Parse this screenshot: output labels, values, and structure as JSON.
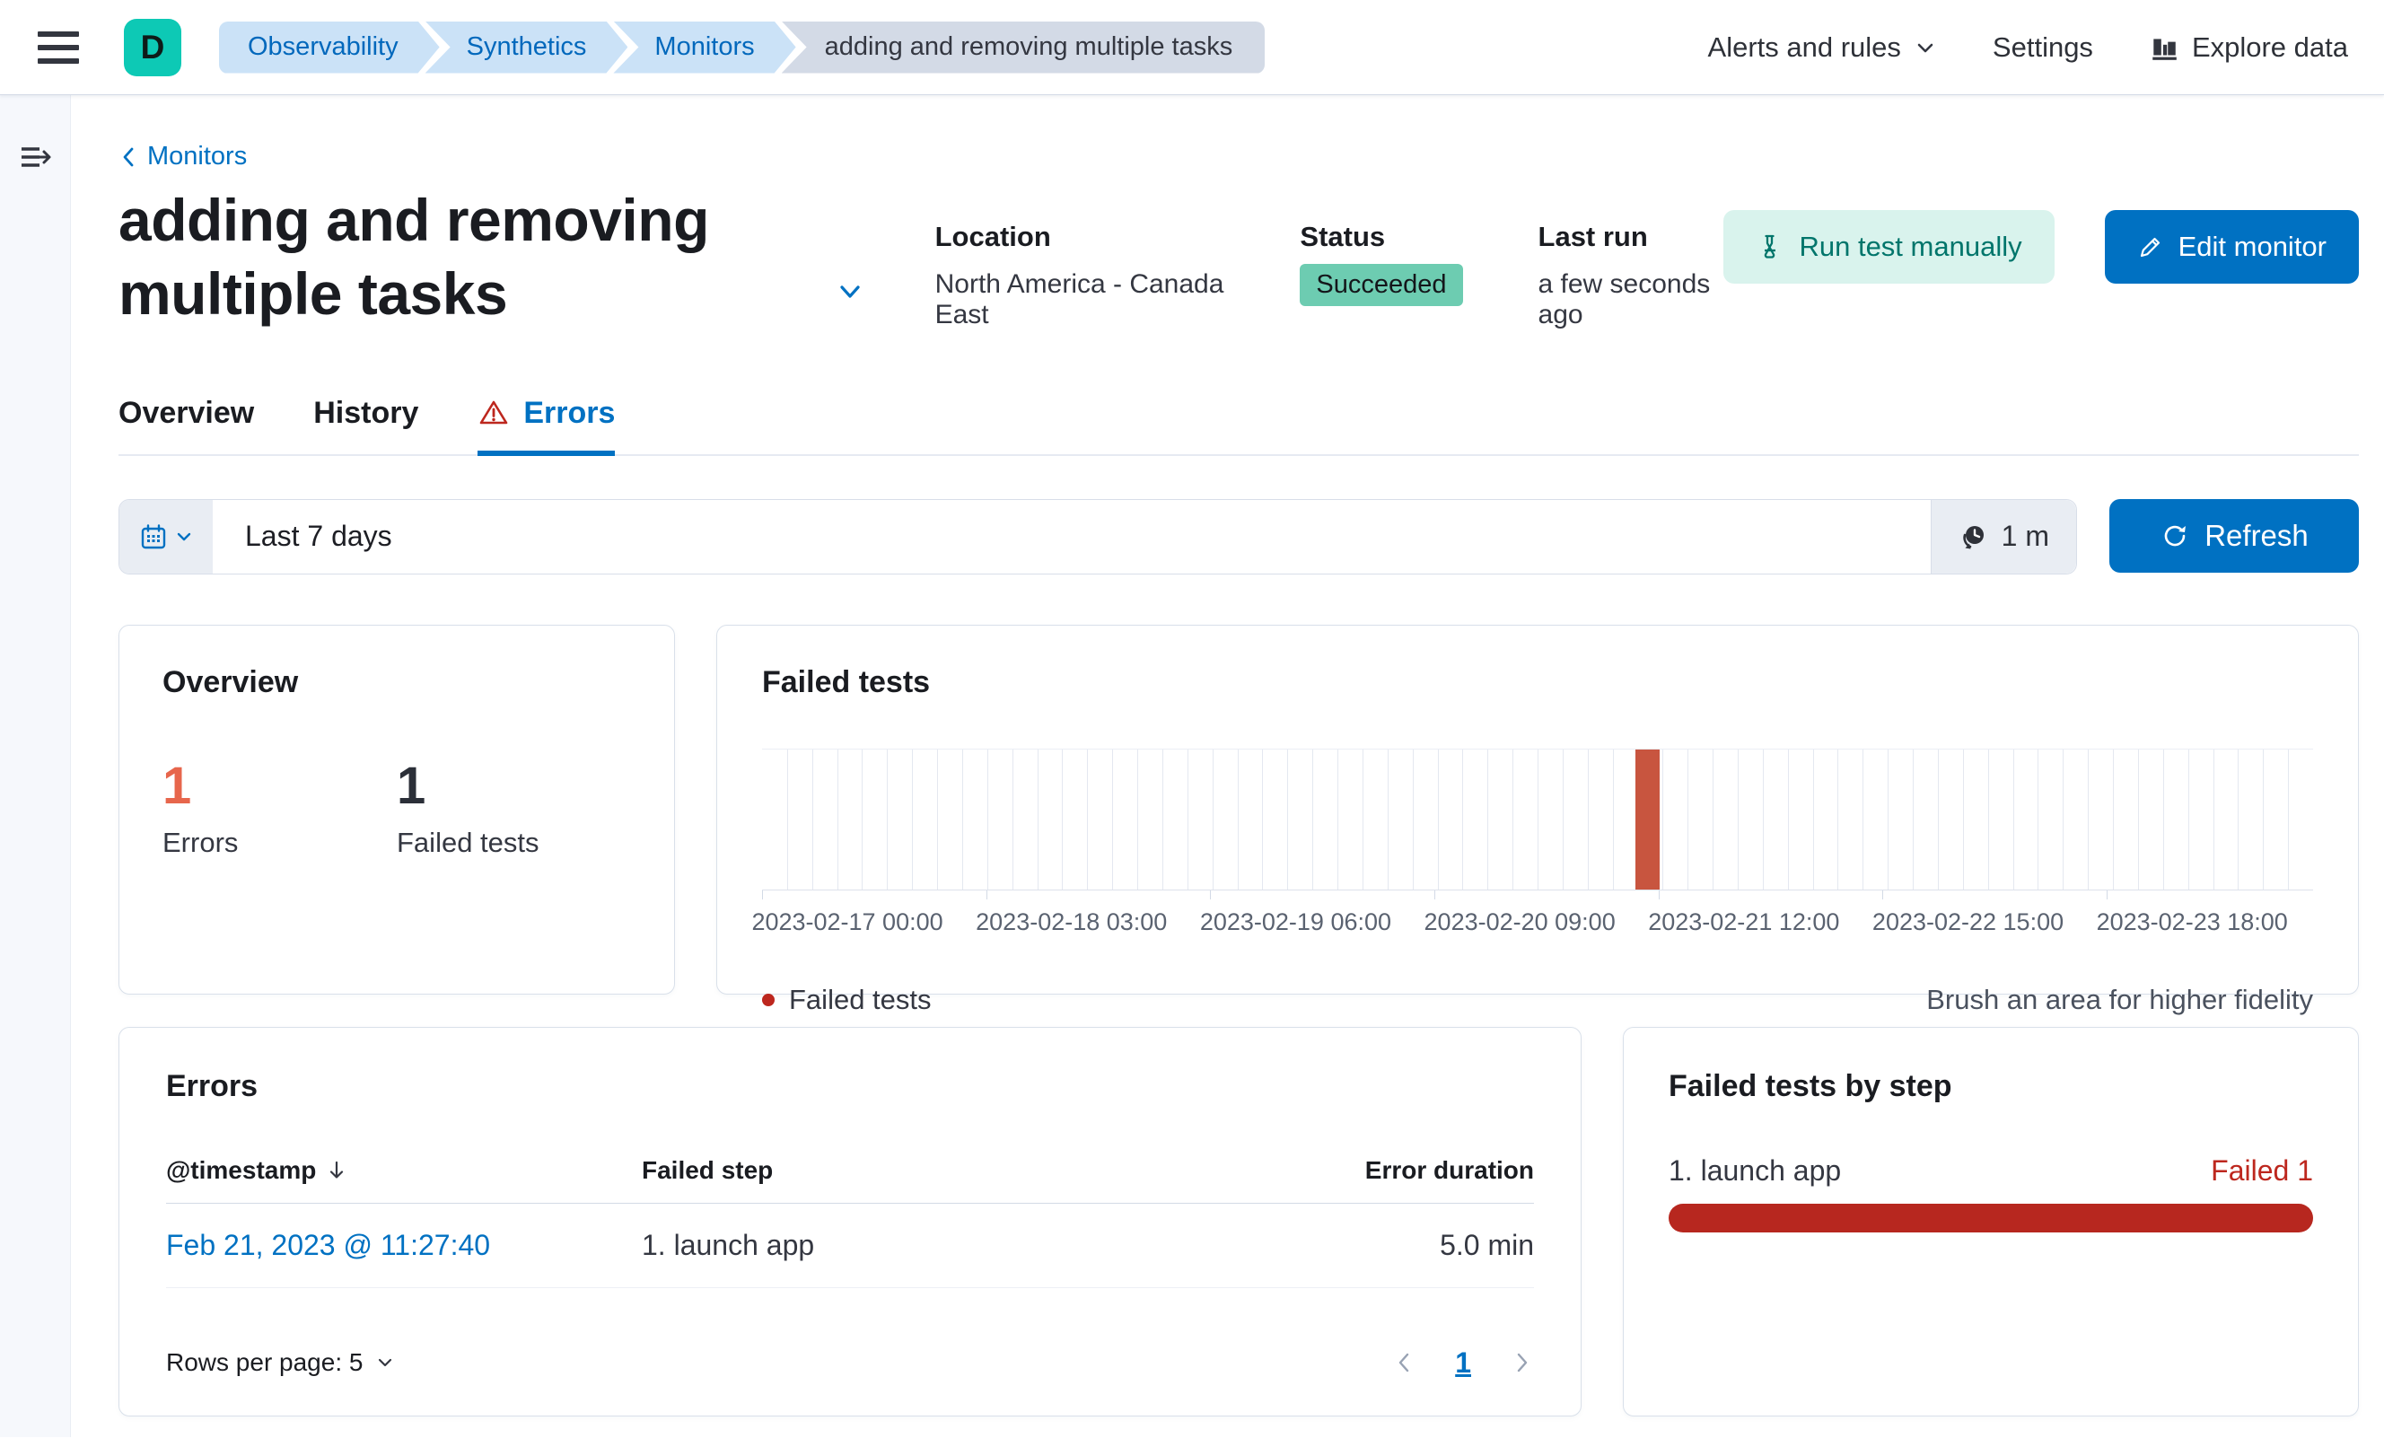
{
  "top_bar": {
    "avatar_initial": "D",
    "breadcrumbs": [
      {
        "label": "Observability"
      },
      {
        "label": "Synthetics"
      },
      {
        "label": "Monitors"
      },
      {
        "label": "adding and removing multiple tasks"
      }
    ],
    "alerts_menu_label": "Alerts and rules",
    "settings_label": "Settings",
    "explore_data_label": "Explore data"
  },
  "page": {
    "back_link": "Monitors",
    "title": "adding and removing multiple tasks",
    "meta": {
      "location_label": "Location",
      "location_value": "North America - Canada East",
      "status_label": "Status",
      "status_value": "Succeeded",
      "last_run_label": "Last run",
      "last_run_value": "a few seconds ago"
    },
    "actions": {
      "run_test_label": "Run test manually",
      "edit_monitor_label": "Edit monitor"
    },
    "tabs": [
      {
        "label": "Overview"
      },
      {
        "label": "History"
      },
      {
        "label": "Errors"
      }
    ]
  },
  "filter_bar": {
    "date_range_value": "Last 7 days",
    "refresh_interval": "1 m",
    "refresh_label": "Refresh"
  },
  "overview_panel": {
    "title": "Overview",
    "errors_count": "1",
    "errors_label": "Errors",
    "failed_count": "1",
    "failed_label": "Failed tests"
  },
  "chart_panel": {
    "title": "Failed tests",
    "legend_label": "Failed tests",
    "brush_hint": "Brush an area for higher fidelity"
  },
  "chart_data": {
    "type": "bar",
    "title": "Failed tests",
    "xlabel": "",
    "ylabel": "",
    "ylim": [
      0,
      1
    ],
    "grid": "vertical",
    "bins": 62,
    "x_ticks": [
      "2023-02-17 00:00",
      "2023-02-18 03:00",
      "2023-02-19 06:00",
      "2023-02-20 09:00",
      "2023-02-21 12:00",
      "2023-02-22 15:00",
      "2023-02-23 18:00"
    ],
    "label_positions_pct": [
      5.5,
      19.95,
      34.4,
      48.85,
      63.3,
      77.75,
      92.2
    ],
    "tick_mark_positions_pct": [
      0,
      14.45,
      28.9,
      43.35,
      57.8,
      72.25,
      86.7
    ],
    "points": [
      {
        "x": "2023-02-21 11:27",
        "y": 1
      }
    ],
    "bar_position_pct": 56.3,
    "bar_width_pct": 1.55,
    "bar_color": "#C8553F",
    "legend": [
      {
        "label": "Failed tests",
        "color": "#BD271E"
      }
    ],
    "legend_position": "bottom-left"
  },
  "errors_panel": {
    "title": "Errors",
    "columns": {
      "timestamp": "@timestamp",
      "failed_step": "Failed step",
      "error_duration": "Error duration"
    },
    "rows": [
      {
        "timestamp": "Feb 21, 2023 @ 11:27:40",
        "failed_step": "1. launch app",
        "error_duration": "5.0 min"
      }
    ],
    "rows_per_page_label": "Rows per page: 5",
    "current_page": "1"
  },
  "step_panel": {
    "title": "Failed tests by step",
    "step_label": "1. launch app",
    "failed_label": "Failed 1",
    "value": 1,
    "max": 1
  },
  "colors": {
    "primary_blue": "#0071C2",
    "danger_red": "#BD271E",
    "bar_red": "#C8553F",
    "soft_red": "#E7664C",
    "success_badge": "#6DCCB1",
    "teal_avatar": "#0DC9B5",
    "crumb_blue_bg": "#CBE2F7",
    "crumb_gray_bg": "#D3DAE6"
  },
  "icons": {
    "menu": "hamburger-icon",
    "expand": "expand-sidebar-icon",
    "alerts_chevron": "chevron-down-icon",
    "explore": "bar-chart-icon",
    "back": "chevron-left-icon",
    "run": "beaker-icon",
    "edit": "pencil-icon",
    "errors_tab": "warning-triangle-icon",
    "calendar": "calendar-icon",
    "interval": "time-refresh-icon",
    "refresh": "refresh-icon",
    "sort": "arrow-down-icon",
    "legend": "dot-icon"
  }
}
